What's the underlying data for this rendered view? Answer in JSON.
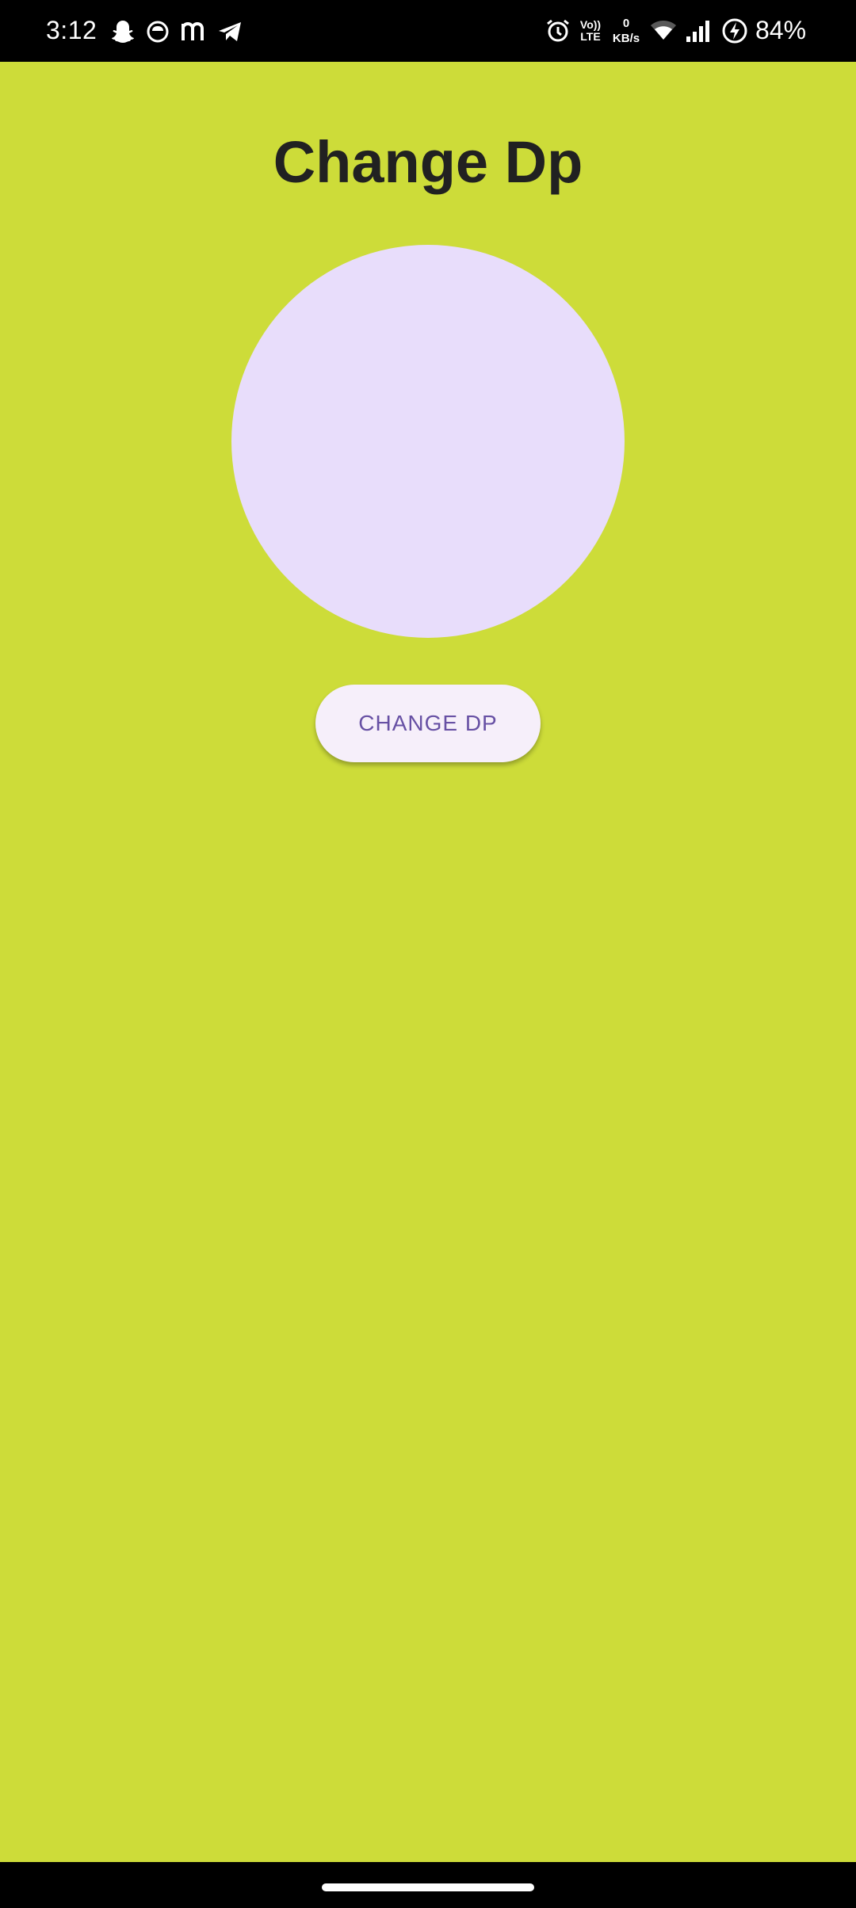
{
  "status_bar": {
    "time": "3:12",
    "notification_icons": [
      "snapchat-icon",
      "app-icon",
      "m-icon",
      "telegram-icon"
    ],
    "volte_line1": "Vo))",
    "volte_line2": "LTE",
    "net_speed_value": "0",
    "net_speed_unit": "KB/s",
    "battery_percent": "84%"
  },
  "screen": {
    "title": "Change Dp",
    "button_label": "CHANGE DP"
  },
  "colors": {
    "background": "#cddc39",
    "avatar_fill": "#e8ddfb",
    "button_bg": "#f6effa",
    "button_text": "#6750a4",
    "title_text": "#212121"
  }
}
